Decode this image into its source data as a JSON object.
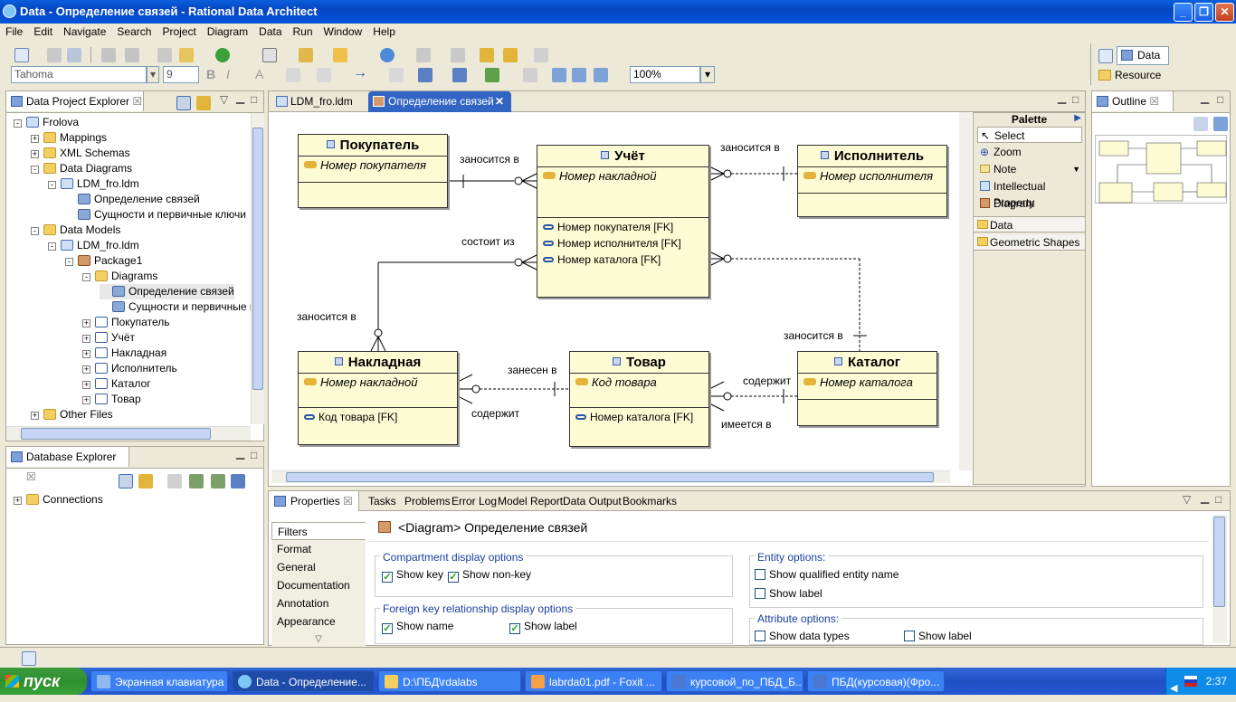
{
  "window": {
    "title": "Data - Определение связей - Rational Data Architect"
  },
  "menu": [
    "File",
    "Edit",
    "Navigate",
    "Search",
    "Project",
    "Diagram",
    "Data",
    "Run",
    "Window",
    "Help"
  ],
  "toolbar": {
    "font": "Tahoma",
    "size": "9",
    "zoom": "100%"
  },
  "perspectives": {
    "data": "Data",
    "resource": "Resource"
  },
  "explorer": {
    "title": "Data Project Explorer",
    "tree": [
      {
        "label": "Frolova",
        "indent": 0,
        "exp": "−",
        "icon": "model"
      },
      {
        "label": "Mappings",
        "indent": 1,
        "exp": "+",
        "icon": "folder"
      },
      {
        "label": "XML Schemas",
        "indent": 1,
        "exp": "+",
        "icon": "folder"
      },
      {
        "label": "Data Diagrams",
        "indent": 1,
        "exp": "−",
        "icon": "folder"
      },
      {
        "label": "LDM_fro.ldm",
        "indent": 2,
        "exp": "−",
        "icon": "model"
      },
      {
        "label": "Определение связей",
        "indent": 3,
        "exp": "",
        "icon": "diag"
      },
      {
        "label": "Сущности и первичные ключи",
        "indent": 3,
        "exp": "",
        "icon": "diag"
      },
      {
        "label": "Data Models",
        "indent": 1,
        "exp": "−",
        "icon": "folder"
      },
      {
        "label": "LDM_fro.ldm",
        "indent": 2,
        "exp": "−",
        "icon": "model"
      },
      {
        "label": "Package1",
        "indent": 3,
        "exp": "−",
        "icon": "pkg"
      },
      {
        "label": "Diagrams",
        "indent": 4,
        "exp": "−",
        "icon": "folder"
      },
      {
        "label": "Определение связей",
        "indent": 5,
        "exp": "",
        "icon": "diag",
        "selected": true
      },
      {
        "label": "Сущности и первичные к",
        "indent": 5,
        "exp": "",
        "icon": "diag"
      },
      {
        "label": "Покупатель",
        "indent": 4,
        "exp": "+",
        "icon": "ent"
      },
      {
        "label": "Учёт",
        "indent": 4,
        "exp": "+",
        "icon": "ent"
      },
      {
        "label": "Накладная",
        "indent": 4,
        "exp": "+",
        "icon": "ent"
      },
      {
        "label": "Исполнитель",
        "indent": 4,
        "exp": "+",
        "icon": "ent"
      },
      {
        "label": "Каталог",
        "indent": 4,
        "exp": "+",
        "icon": "ent"
      },
      {
        "label": "Товар",
        "indent": 4,
        "exp": "+",
        "icon": "ent"
      },
      {
        "label": "Other Files",
        "indent": 1,
        "exp": "+",
        "icon": "folder"
      }
    ]
  },
  "dbexplorer": {
    "title": "Database Explorer",
    "connections": "Connections"
  },
  "editor": {
    "tabs": [
      "LDM_fro.ldm",
      "Определение связей"
    ]
  },
  "diagram": {
    "entities": [
      {
        "id": "pokupatel",
        "name": "Покупатель",
        "key": "Номер покупателя",
        "attrs": []
      },
      {
        "id": "uchet",
        "name": "Учёт",
        "key": "Номер накладной",
        "attrs": [
          "Номер покупателя [FK]",
          "Номер исполнителя [FK]",
          "Номер каталога [FK]"
        ]
      },
      {
        "id": "ispolnitel",
        "name": "Исполнитель",
        "key": "Номер исполнителя",
        "attrs": []
      },
      {
        "id": "nakladnaya",
        "name": "Накладная",
        "key": "Номер накладной",
        "attrs": [
          "Код товара [FK]"
        ]
      },
      {
        "id": "tovar",
        "name": "Товар",
        "key": "Код товара",
        "attrs": [
          "Номер каталога [FK]"
        ]
      },
      {
        "id": "katalog",
        "name": "Каталог",
        "key": "Номер каталога",
        "attrs": []
      }
    ],
    "relations": {
      "r1": "заносится в",
      "r2": "заносится в",
      "r3": "состоит из",
      "r4": "заносится в",
      "r5": "заносится в",
      "r6": "занесен в",
      "r7": "содержит",
      "r8": "содержит",
      "r9": "имеется в"
    }
  },
  "palette": {
    "title": "Palette",
    "items": [
      "Select",
      "Zoom",
      "Note",
      "Intellectual Property",
      "Diagram"
    ],
    "drawers": [
      "Data",
      "Geometric Shapes"
    ]
  },
  "outline": {
    "title": "Outline"
  },
  "bottom": {
    "tabs": [
      "Properties",
      "Tasks",
      "Problems",
      "Error Log",
      "Model Report",
      "Data Output",
      "Bookmarks"
    ]
  },
  "properties": {
    "header": "<Diagram> Определение связей",
    "side_tabs": [
      "Filters",
      "Format",
      "General",
      "Documentation",
      "Annotation",
      "Appearance"
    ],
    "compartment": {
      "title": "Compartment display options",
      "show_key": "Show key",
      "show_nonkey": "Show non-key"
    },
    "fk": {
      "title": "Foreign key relationship display options",
      "show_name": "Show name",
      "show_label": "Show label"
    },
    "entity": {
      "title": "Entity options:",
      "qualified": "Show qualified entity name",
      "label": "Show label"
    },
    "attribute": {
      "title": "Attribute options:",
      "types": "Show data types",
      "label": "Show label"
    }
  },
  "taskbar": {
    "start": "пуск",
    "items": [
      "Экранная клавиатура",
      "Data - Определение...",
      "D:\\ПБД\\rdalabs",
      "labrda01.pdf - Foxit ...",
      "курсовой_по_ПБД_Б...",
      "ПБД(курсовая)(Фро..."
    ],
    "clock": "2:37"
  }
}
